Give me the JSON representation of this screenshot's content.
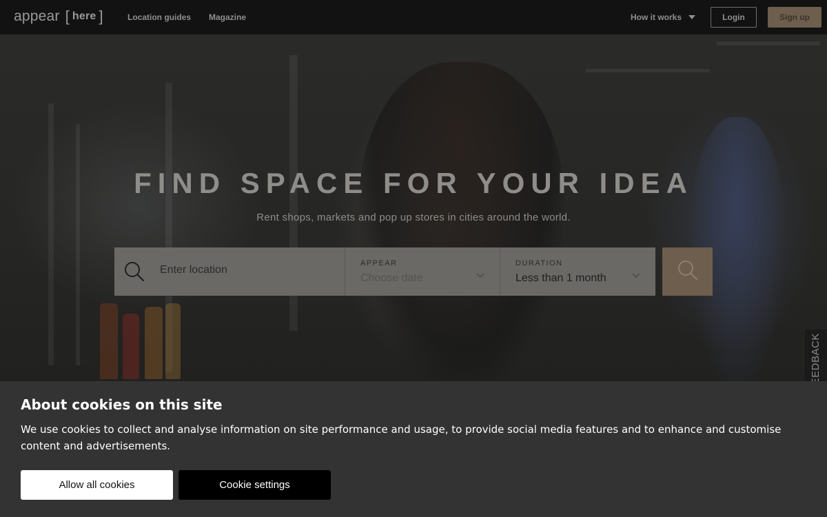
{
  "nav": {
    "logo_main": "appear",
    "logo_here": "here",
    "links": [
      "Location guides",
      "Magazine"
    ],
    "how_it_works": "How it works",
    "login": "Login",
    "signup": "Sign up"
  },
  "hero": {
    "headline": "FIND SPACE FOR YOUR IDEA",
    "subline": "Rent shops, markets and pop up stores in cities around the world."
  },
  "search": {
    "location_placeholder": "Enter location",
    "appear_label": "APPEAR",
    "appear_value": "Choose date",
    "duration_label": "DURATION",
    "duration_value": "Less than 1 month",
    "icon": "search-icon"
  },
  "feedback": {
    "label": "FEEDBACK"
  },
  "cookie": {
    "title": "About cookies on this site",
    "text": "We use cookies to collect and analyse information on site performance and usage, to provide social media features and to enhance and customise content and advertisements.",
    "allow": "Allow all cookies",
    "settings": "Cookie settings"
  },
  "colors": {
    "accent": "#6d5e4d",
    "nav_bg": "#121212",
    "banner_bg": "#333333"
  }
}
